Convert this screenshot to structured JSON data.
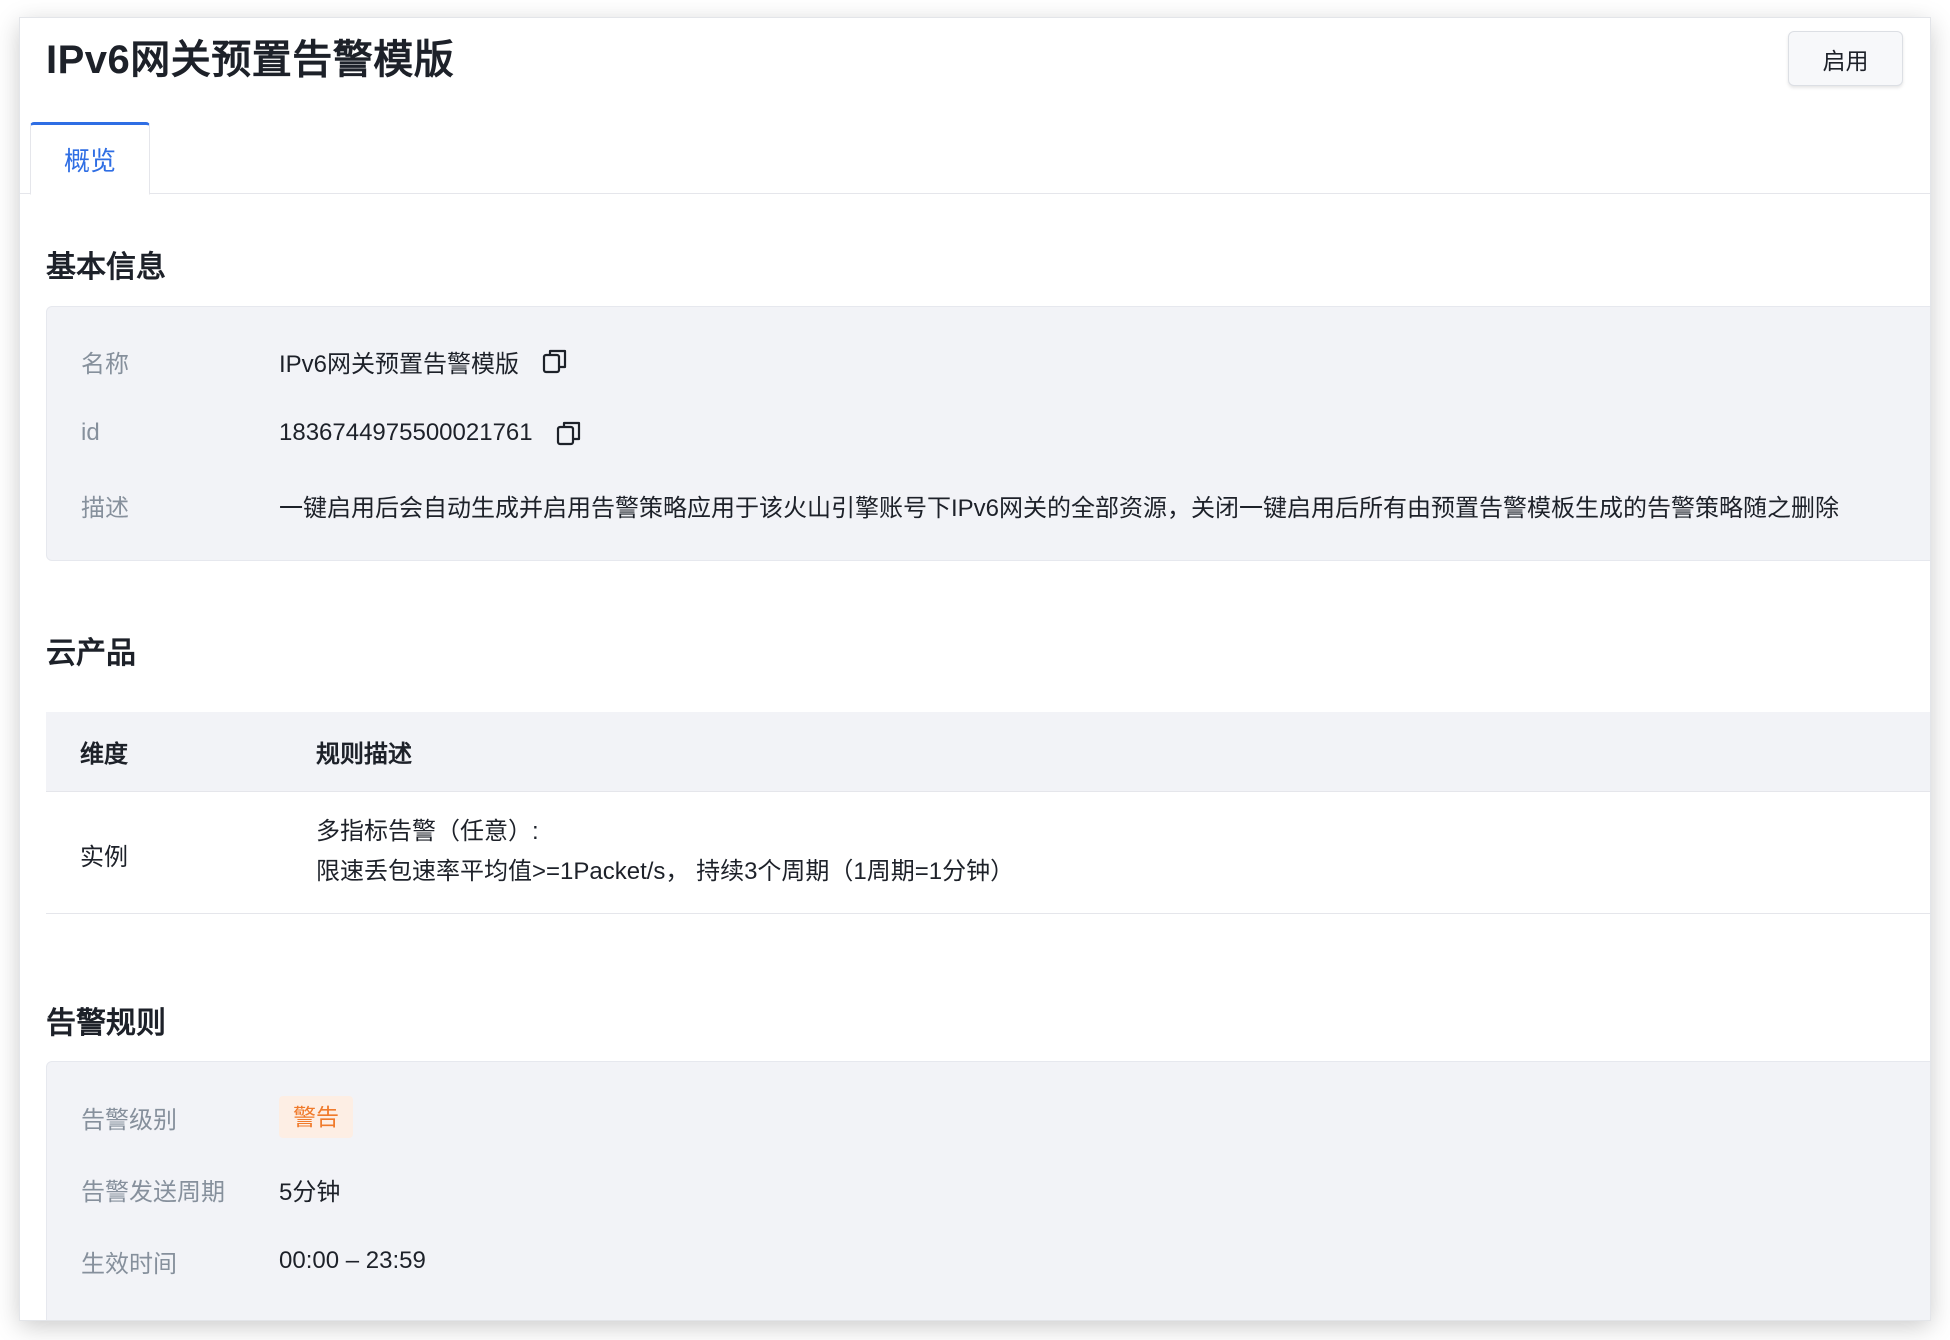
{
  "header": {
    "title": "IPv6网关预置告警模版",
    "enable_button": "启用"
  },
  "tabs": [
    {
      "label": "概览",
      "active": true
    }
  ],
  "basic_info": {
    "section_title": "基本信息",
    "rows": [
      {
        "label": "名称",
        "value": "IPv6网关预置告警模版",
        "copyable": true
      },
      {
        "label": "id",
        "value": "1836744975500021761",
        "copyable": true
      },
      {
        "label": "描述",
        "value": "一键启用后会自动生成并启用告警策略应用于该火山引擎账号下IPv6网关的全部资源，关闭一键启用后所有由预置告警模板生成的告警策略随之删除",
        "copyable": false
      }
    ]
  },
  "cloud_product": {
    "section_title": "云产品",
    "columns": [
      "维度",
      "规则描述"
    ],
    "rows": [
      {
        "dimension": "实例",
        "rule_lines": [
          "多指标告警（任意）:",
          "限速丢包速率平均值>=1Packet/s， 持续3个周期（1周期=1分钟）"
        ]
      }
    ]
  },
  "alert_rules": {
    "section_title": "告警规则",
    "level_label": "告警级别",
    "level_value": "警告",
    "period_label": "告警发送周期",
    "period_value": "5分钟",
    "effective_label": "生效时间",
    "effective_value": "00:00 – 23:59"
  },
  "icons": {
    "copy": "copy-icon"
  },
  "colors": {
    "accent": "#2f6ee4",
    "warning_text": "#f07a2b",
    "warning_bg": "#fdeee4",
    "card_bg": "#f2f3f7",
    "label": "#86909c"
  }
}
